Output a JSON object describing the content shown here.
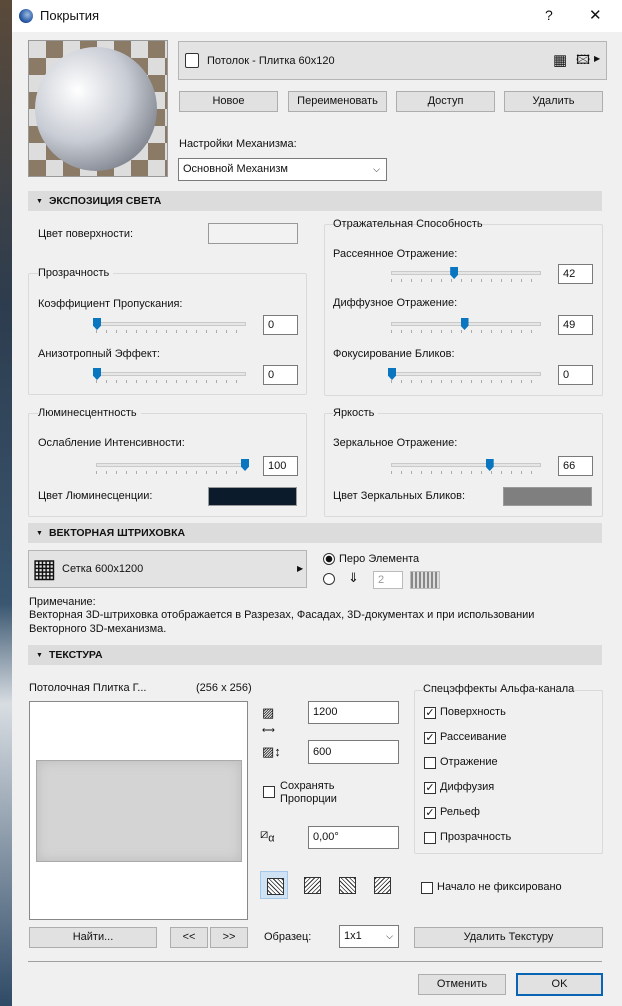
{
  "window": {
    "title": "Покрытия",
    "help": "?",
    "close": "✕"
  },
  "material": {
    "name": "Потолок - Плитка 60x120"
  },
  "buttons": {
    "new": "Новое",
    "rename": "Переименовать",
    "access": "Доступ",
    "delete": "Удалить"
  },
  "engine": {
    "label": "Настройки Механизма:",
    "value": "Основной Механизм"
  },
  "sections": {
    "light": "ЭКСПОЗИЦИЯ СВЕТА",
    "vector": "ВЕКТОРНАЯ ШТРИХОВКА",
    "texture": "ТЕКСТУРА"
  },
  "light": {
    "surface_color_label": "Цвет поверхности:",
    "surface_color": "#f2f2f2",
    "transparency": {
      "title": "Прозрачность",
      "transmission_label": "Коэффициент Пропускания:",
      "transmission": 0,
      "anisotropic_label": "Анизотропный Эффект:",
      "anisotropic": 0
    },
    "reflectance": {
      "title": "Отражательная Способность",
      "ambient_label": "Рассеянное Отражение:",
      "ambient": 42,
      "diffuse_label": "Диффузное Отражение:",
      "diffuse": 49,
      "focus_label": "Фокусирование Бликов:",
      "focus": 0
    },
    "luminance": {
      "title": "Люминесцентность",
      "attenuation_label": "Ослабление Интенсивности:",
      "attenuation": 100,
      "color_label": "Цвет Люминесценции:",
      "color": "#0b1b2c"
    },
    "brightness": {
      "title": "Яркость",
      "specular_label": "Зеркальное Отражение:",
      "specular": 66,
      "color_label": "Цвет Зеркальных Бликов:",
      "color": "#7f7f7f"
    }
  },
  "vector": {
    "hatch": "Сетка 600x1200",
    "pen_element": "Перо Элемента",
    "pen": "2",
    "note_title": "Примечание:",
    "note_line1": "Векторная 3D-штриховка отображается в Разрезах, Фасадах, 3D-документах и при использовании",
    "note_line2": "Векторного 3D-механизма."
  },
  "texture": {
    "name": "Потолочная Плитка Г...",
    "size": "(256 x 256)",
    "width": "1200",
    "height": "600",
    "keep_ratio_1": "Сохранять",
    "keep_ratio_2": "Пропорции",
    "angle": "0,00°",
    "alpha_title": "Спецэффекты Альфа-канала",
    "alpha": [
      {
        "label": "Поверхность",
        "checked": true
      },
      {
        "label": "Рассеивание",
        "checked": true
      },
      {
        "label": "Отражение",
        "checked": false
      },
      {
        "label": "Диффузия",
        "checked": true
      },
      {
        "label": "Рельеф",
        "checked": true
      },
      {
        "label": "Прозрачность",
        "checked": false
      }
    ],
    "origin_label": "Начало не фиксировано",
    "find": "Найти...",
    "prev": "<<",
    "next": ">>",
    "sample_label": "Образец:",
    "sample": "1x1",
    "delete": "Удалить Текстуру"
  },
  "footer": {
    "cancel": "Отменить",
    "ok": "OK"
  }
}
